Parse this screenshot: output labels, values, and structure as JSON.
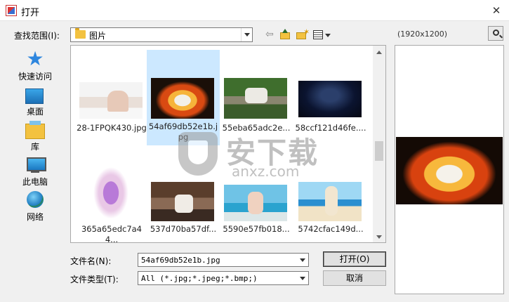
{
  "window": {
    "title": "打开",
    "close_glyph": "✕"
  },
  "lookin": {
    "label": "查找范围(I):",
    "value": "图片"
  },
  "toolbar": {
    "back_glyph": "⇦"
  },
  "places": [
    {
      "label": "快速访问",
      "icon": "star-icon"
    },
    {
      "label": "桌面",
      "icon": "desktop-icon"
    },
    {
      "label": "库",
      "icon": "library-icon"
    },
    {
      "label": "此电脑",
      "icon": "computer-icon"
    },
    {
      "label": "网络",
      "icon": "network-icon"
    }
  ],
  "files": [
    {
      "name": "28-1FPQK430.jpg",
      "selected": false
    },
    {
      "name": "54af69db52e1b.jpg",
      "selected": true
    },
    {
      "name": "55eba65adc2e...",
      "selected": false
    },
    {
      "name": "58ccf121d46fe....",
      "selected": false
    },
    {
      "name": "365a65edc7a44...",
      "selected": false
    },
    {
      "name": "537d70ba57df...",
      "selected": false
    },
    {
      "name": "5590e57fb018...",
      "selected": false
    },
    {
      "name": "5742cfac149d...",
      "selected": false
    }
  ],
  "watermark": {
    "cn": "安下载",
    "en": "anxz.com"
  },
  "filename": {
    "label": "文件名(N):",
    "value": "54af69db52e1b.jpg"
  },
  "filetype": {
    "label": "文件类型(T):",
    "value": "All (*.jpg;*.jpeg;*.bmp;)"
  },
  "buttons": {
    "open": "打开(O)",
    "cancel": "取消"
  },
  "preview": {
    "dimensions": "(1920x1200)"
  },
  "colors": {
    "selection": "#cce8ff",
    "accent": "#2e86de"
  }
}
